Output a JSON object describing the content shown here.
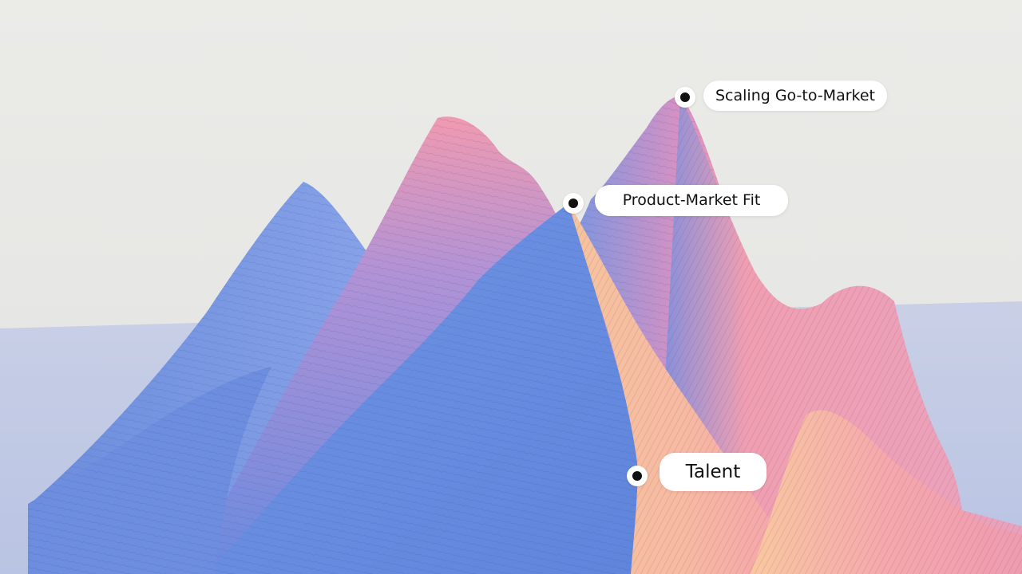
{
  "labels": {
    "scaling_gtm": "Scaling Go-to-Market",
    "product_market_fit": "Product-Market Fit",
    "talent": "Talent"
  },
  "colors": {
    "sky": "#e9e9e7",
    "blue": "#6f8fdf",
    "blue_dark": "#5774c9",
    "pink": "#f09aac",
    "peach": "#f6c7a2",
    "marker": "#111111",
    "pill": "#ffffff"
  }
}
